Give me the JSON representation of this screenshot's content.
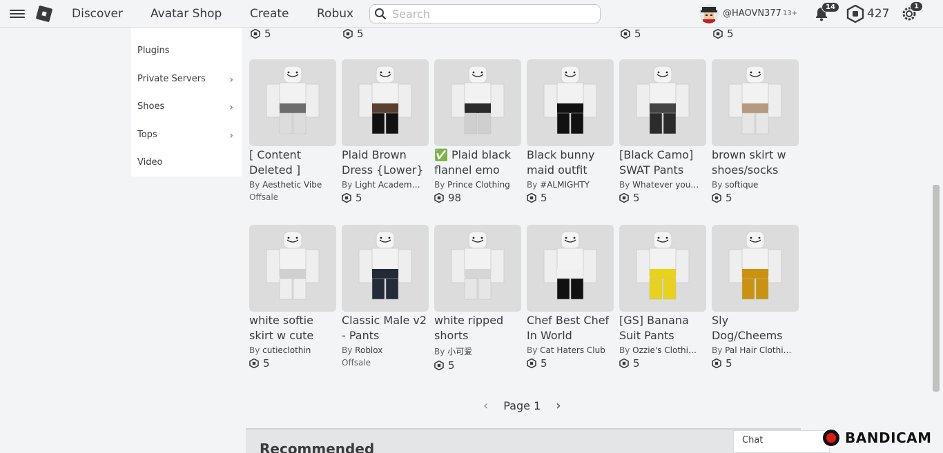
{
  "nav": {
    "links": [
      "Discover",
      "Avatar Shop",
      "Create",
      "Robux"
    ],
    "search_placeholder": "Search",
    "username": "@HAOVN377",
    "age_label": "13+",
    "notifications": "14",
    "robux": "427",
    "settings_badge": "1"
  },
  "sidebar": {
    "items": [
      {
        "label": "Plugins",
        "chevron": false
      },
      {
        "label": "Private Servers",
        "chevron": true
      },
      {
        "label": "Shoes",
        "chevron": true
      },
      {
        "label": "Tops",
        "chevron": true
      },
      {
        "label": "Video",
        "chevron": false
      }
    ]
  },
  "top_partial_prices": [
    "5",
    "5",
    "5",
    "5"
  ],
  "rows": [
    [
      {
        "name": "[ Content Deleted ]",
        "by": "By",
        "creator": "Aesthetic Vibe",
        "price": "",
        "offsale": "Offsale",
        "pants": "#dcdcdc",
        "detail": "#6d6d6d"
      },
      {
        "name": "Plaid Brown Dress {Lower}",
        "by": "By",
        "creator": "Light Academ…",
        "price": "5",
        "offsale": "",
        "pants": "#111111",
        "detail": "#5a4030"
      },
      {
        "name": "✅ Plaid black flannel emo",
        "by": "By",
        "creator": "Prince Clothing",
        "price": "98",
        "offsale": "",
        "pants": "#cfcfcf",
        "detail": "#2a2a2a"
      },
      {
        "name": "Black bunny maid outfit",
        "by": "By",
        "creator": "#ALMIGHTY",
        "price": "5",
        "offsale": "",
        "pants": "#111111",
        "detail": "#111111"
      },
      {
        "name": "[Black Camo] SWAT Pants",
        "by": "By",
        "creator": "Whatever you…",
        "price": "5",
        "offsale": "",
        "pants": "#2b2b2b",
        "detail": "#444444"
      },
      {
        "name": "brown skirt w shoes/socks",
        "by": "By",
        "creator": "softique",
        "price": "5",
        "offsale": "",
        "pants": "#e6e6e6",
        "detail": "#b59a82"
      }
    ],
    [
      {
        "name": "white softie skirt w cute",
        "by": "By",
        "creator": "cutieclothin",
        "price": "5",
        "offsale": "",
        "pants": "#eeeeee",
        "detail": "#d0d0d0"
      },
      {
        "name": "Classic Male v2 - Pants",
        "by": "By",
        "creator": "Roblox",
        "price": "",
        "offsale": "Offsale",
        "pants": "#252a38",
        "detail": "#252a38"
      },
      {
        "name": "white ripped shorts",
        "by": "By",
        "creator": "小可爱",
        "price": "5",
        "offsale": "",
        "pants": "#e6e6e6",
        "detail": "#d6d6d6"
      },
      {
        "name": "Chef Best Chef In World",
        "by": "By",
        "creator": "Cat Haters Club",
        "price": "5",
        "offsale": "",
        "pants": "#111111",
        "detail": "#f0f0f0"
      },
      {
        "name": "[GS] Banana Suit Pants",
        "by": "By",
        "creator": "Ozzie's Clothi…",
        "price": "5",
        "offsale": "",
        "pants": "#e9d21c",
        "detail": "#e9d21c"
      },
      {
        "name": "Sly Dog/Cheems",
        "by": "By",
        "creator": "Pal Hair Clothi…",
        "price": "5",
        "offsale": "",
        "pants": "#c9930f",
        "detail": "#c9930f"
      }
    ]
  ],
  "pager": {
    "label": "Page 1"
  },
  "recommended_title": "Recommended",
  "chat_label": "Chat",
  "recorder_label": "BANDICAM"
}
